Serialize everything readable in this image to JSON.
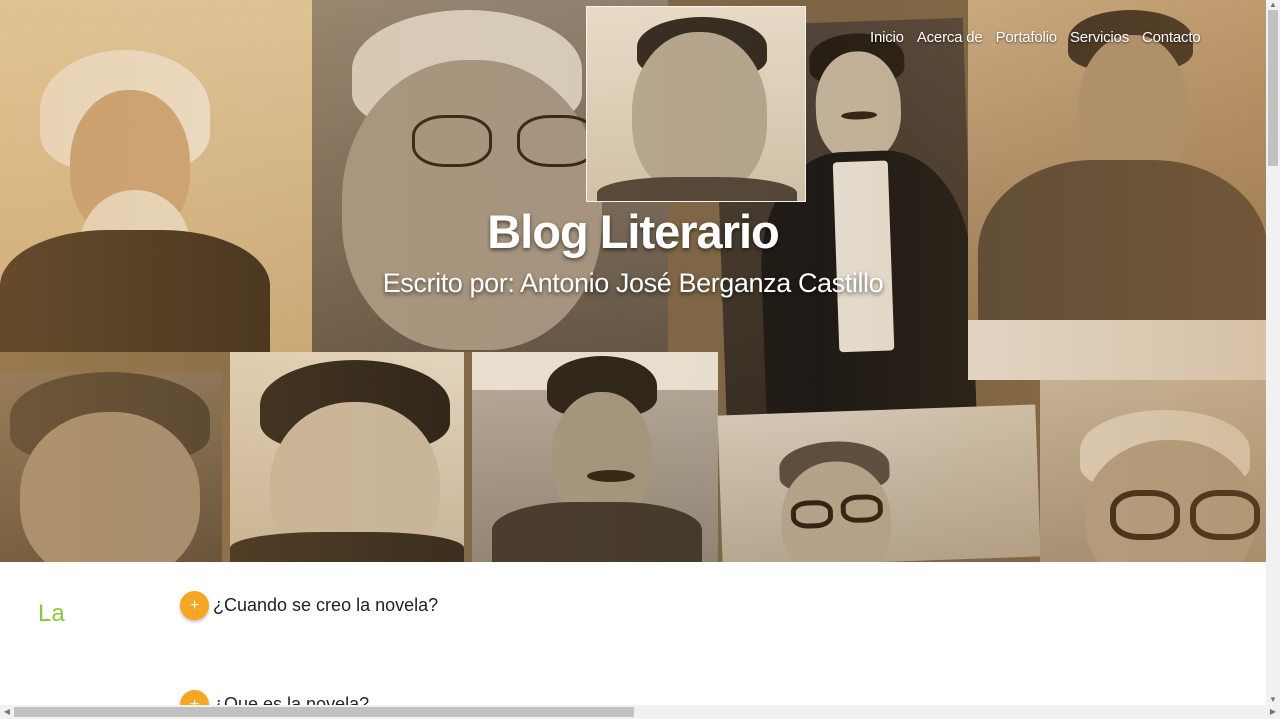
{
  "nav": {
    "items": [
      {
        "label": "Inicio"
      },
      {
        "label": "Acerca de"
      },
      {
        "label": "Portafolio"
      },
      {
        "label": "Servicios"
      },
      {
        "label": "Contacto"
      }
    ]
  },
  "hero": {
    "title": "Blog Literario",
    "subtitle": "Escrito por: Antonio José Berganza Castillo"
  },
  "content": {
    "side_word": "La",
    "faq": [
      {
        "question": "¿Cuando se creo la novela?",
        "icon": "plus-icon"
      },
      {
        "question": "¿Que es la novela?",
        "icon": "plus-icon"
      }
    ]
  },
  "colors": {
    "accent_orange": "#f5a623",
    "accent_green": "#8cc63f",
    "sepia": "#7a6346"
  }
}
